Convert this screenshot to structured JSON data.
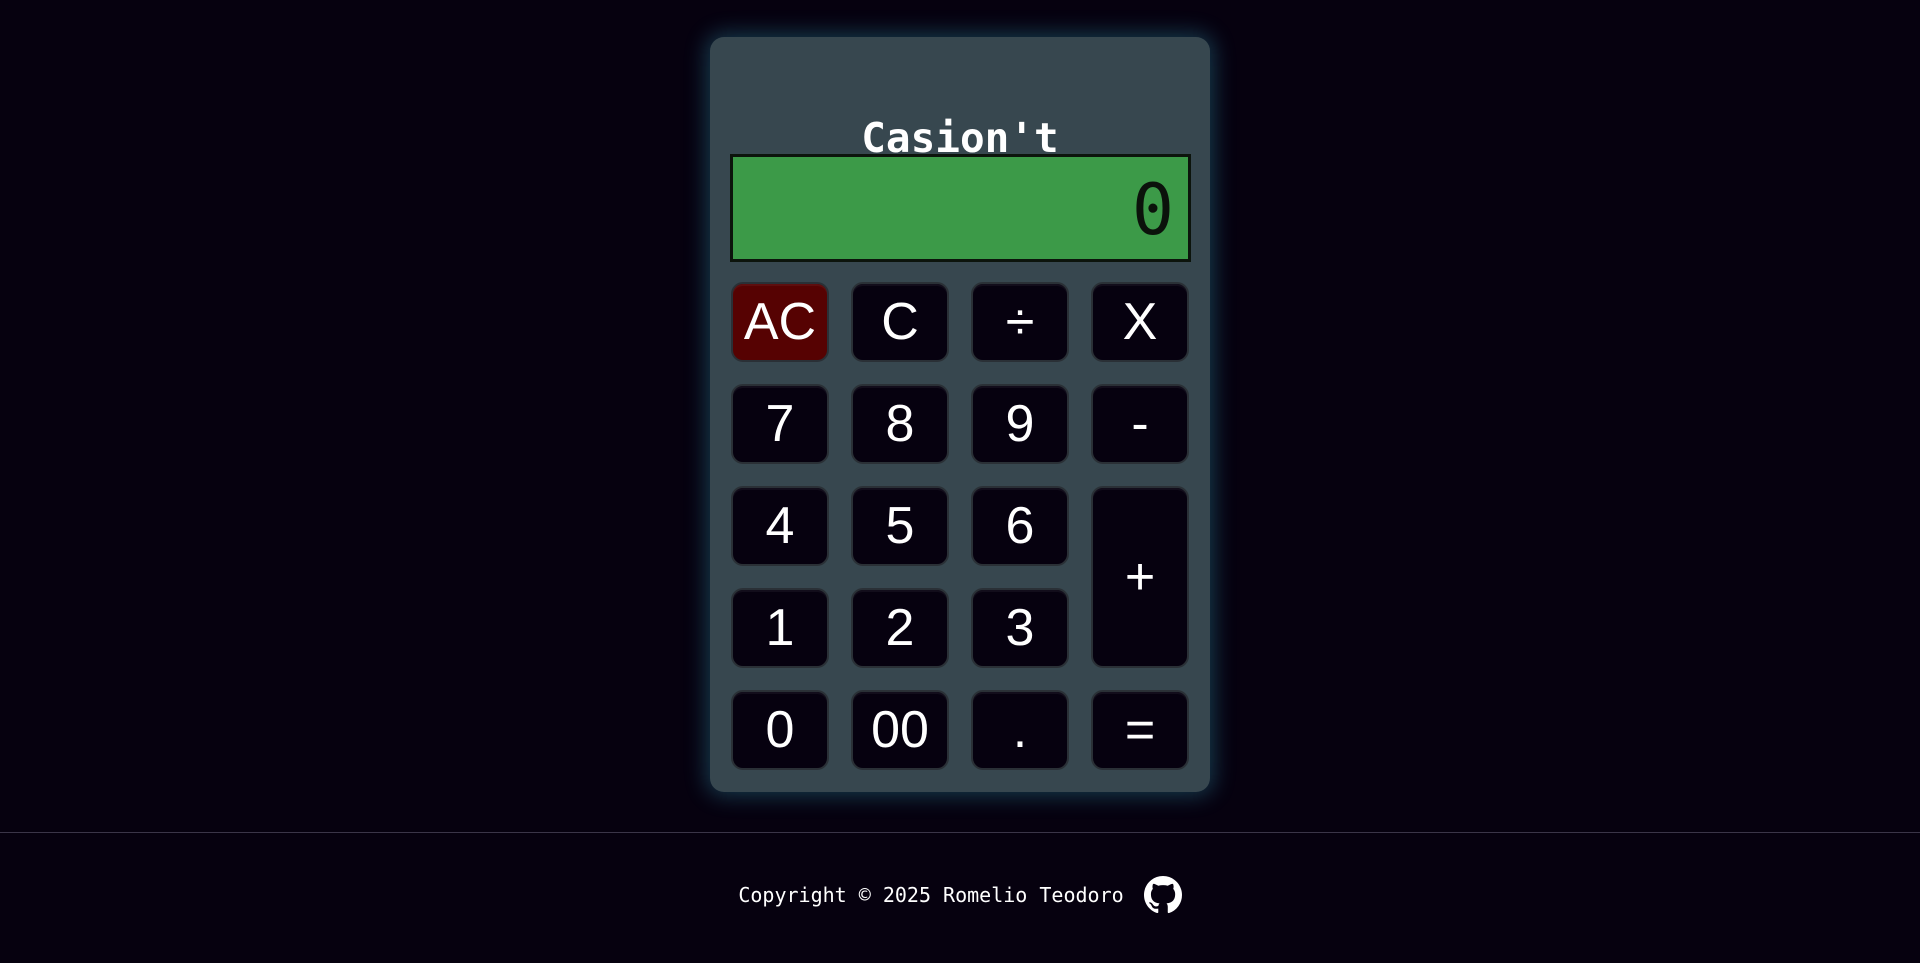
{
  "calculator": {
    "title": "Casion't",
    "display_value": "0",
    "keys": {
      "ac": "AC",
      "c": "C",
      "divide": "÷",
      "multiply": "X",
      "seven": "7",
      "eight": "8",
      "nine": "9",
      "minus": "-",
      "four": "4",
      "five": "5",
      "six": "6",
      "plus": "+",
      "one": "1",
      "two": "2",
      "three": "3",
      "zero": "0",
      "double_zero": "00",
      "decimal": ".",
      "equals": "="
    }
  },
  "footer": {
    "copyright": "Copyright © 2025 Romelio Teodoro",
    "icon": "github-icon"
  },
  "colors": {
    "background": "#06010f",
    "calculator_body": "#37474f",
    "display": "#3c9a48",
    "ac_button": "#560202",
    "key": "#06010f"
  }
}
